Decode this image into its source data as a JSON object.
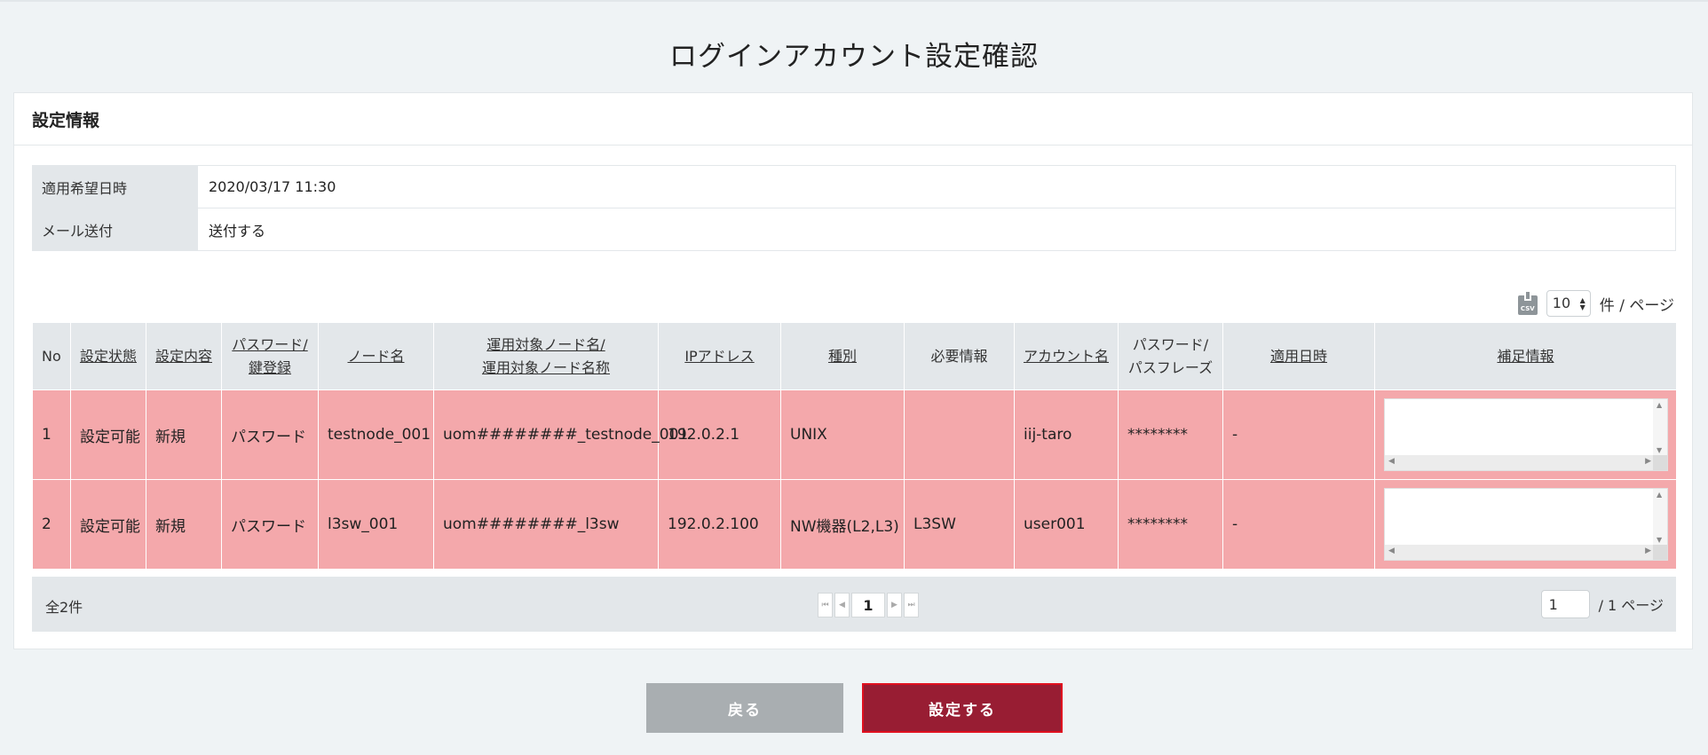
{
  "page": {
    "title": "ログインアカウント設定確認"
  },
  "panel": {
    "title": "設定情報"
  },
  "info": [
    {
      "label": "適用希望日時",
      "value": "2020/03/17 11:30"
    },
    {
      "label": "メール送付",
      "value": "送付する"
    }
  ],
  "toolbar": {
    "csv_icon_text": "CSV",
    "per_page": "10",
    "per_page_suffix": "件 / ページ"
  },
  "columns": [
    "No",
    "設定状態",
    "設定内容",
    "パスワード/",
    "鍵登録",
    "ノード名",
    "運用対象ノード名/",
    "運用対象ノード名称",
    "IPアドレス",
    "種別",
    "必要情報",
    "アカウント名",
    "パスワード/",
    "パスフレーズ",
    "適用日時",
    "補足情報"
  ],
  "rows": [
    {
      "no": "1",
      "status": "設定可能",
      "content": "新規",
      "auth": "パスワード",
      "node": "testnode_001",
      "target": "uom########_testnode_001",
      "ip": "192.0.2.1",
      "type": "UNIX",
      "required": "",
      "account": "iij-taro",
      "password": "********",
      "applied": "-"
    },
    {
      "no": "2",
      "status": "設定可能",
      "content": "新規",
      "auth": "パスワード",
      "node": "l3sw_001",
      "target": "uom########_l3sw",
      "ip": "192.0.2.100",
      "type": "NW機器(L2,L3)",
      "required": "L3SW",
      "account": "user001",
      "password": "********",
      "applied": "-"
    }
  ],
  "footer": {
    "total": "全2件",
    "current_page": "1",
    "page_input": "1",
    "page_suffix": "/  1 ページ"
  },
  "buttons": {
    "back": "戻る",
    "submit": "設定する"
  },
  "colors": {
    "row_bg": "#f4a8ab",
    "submit_bg": "#981d33",
    "back_bg": "#a9aeb1",
    "header_bg": "#e3e7ea"
  }
}
